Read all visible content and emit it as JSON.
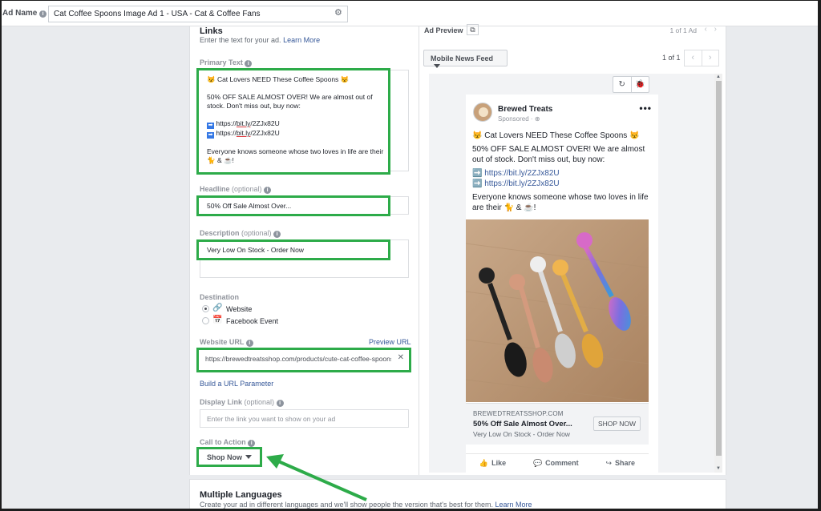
{
  "header": {
    "ad_name_label": "Ad Name",
    "ad_name_value": "Cat Coffee Spoons Image Ad 1 - USA - Cat & Coffee Fans"
  },
  "links": {
    "title": "Links",
    "subtitle": "Enter the text for your ad.",
    "learn_more": "Learn More",
    "primary_text_label": "Primary Text",
    "primary_text": {
      "line1": "😾 Cat Lovers NEED These Coffee Spoons 😾",
      "line2": "50% OFF SALE ALMOST OVER! We are almost out of stock. Don't miss out, buy now:",
      "url_prefix": "https://",
      "url_host": "bit.ly",
      "url_path": "/2ZJx82U",
      "line4": "Everyone knows someone whose two loves in life are their",
      "line4b": "🐈 & ☕!"
    },
    "headline_label": "Headline",
    "headline_optional": "(optional)",
    "headline_value": "50% Off Sale Almost Over...",
    "description_label": "Description",
    "description_optional": "(optional)",
    "description_value": "Very Low On Stock - Order Now",
    "destination_label": "Destination",
    "destination_options": [
      "Website",
      "Facebook Event"
    ],
    "website_url_label": "Website URL",
    "preview_url": "Preview URL",
    "website_url_value": "https://brewedtreatsshop.com/products/cute-cat-coffee-spoons",
    "build_url_param": "Build a URL Parameter",
    "display_link_label": "Display Link",
    "display_link_optional": "(optional)",
    "display_link_placeholder": "Enter the link you want to show on your ad",
    "cta_label": "Call to Action",
    "cta_value": "Shop Now"
  },
  "multiple_languages": {
    "title": "Multiple Languages",
    "subtitle": "Create your ad in different languages and we'll show people the version that's best for them.",
    "learn_more": "Learn More"
  },
  "preview": {
    "title": "Ad Preview",
    "count": "1 of 1 Ad",
    "placement": "Mobile News Feed",
    "page_count": "1 of 1",
    "post": {
      "page_name": "Brewed Treats",
      "sponsored": "Sponsored ·",
      "line1": "😾 Cat Lovers NEED These Coffee Spoons 😾",
      "line2": "50% OFF SALE ALMOST OVER! We are almost out of stock. Don't miss out, buy now:",
      "link1": "➡️ https://bit.ly/2ZJx82U",
      "link2": "➡️ https://bit.ly/2ZJx82U",
      "line3": "Everyone knows someone whose two loves in life are their 🐈 & ☕!",
      "card_domain": "BREWEDTREATSSHOP.COM",
      "card_headline": "50% Off Sale Almost Over...",
      "card_desc": "Very Low On Stock - Order Now",
      "card_button": "SHOP NOW",
      "like": "Like",
      "comment": "Comment",
      "share": "Share"
    }
  },
  "colors": {
    "highlight": "#2dab49",
    "link": "#365899",
    "fb_bg": "#e9ebee"
  }
}
